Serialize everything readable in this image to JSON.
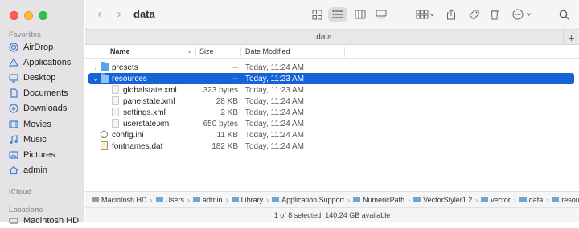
{
  "window": {
    "title": "data"
  },
  "sidebar": {
    "favorites_label": "Favorites",
    "items": [
      {
        "label": "AirDrop",
        "icon": "airdrop-icon"
      },
      {
        "label": "Applications",
        "icon": "applications-icon"
      },
      {
        "label": "Desktop",
        "icon": "desktop-icon"
      },
      {
        "label": "Documents",
        "icon": "documents-icon"
      },
      {
        "label": "Downloads",
        "icon": "downloads-icon"
      },
      {
        "label": "Movies",
        "icon": "movies-icon"
      },
      {
        "label": "Music",
        "icon": "music-icon"
      },
      {
        "label": "Pictures",
        "icon": "pictures-icon"
      },
      {
        "label": "admin",
        "icon": "home-icon"
      }
    ],
    "icloud_label": "iCloud",
    "locations_label": "Locations",
    "locations": [
      {
        "label": "Macintosh HD",
        "icon": "harddrive-icon"
      }
    ]
  },
  "tabbar": {
    "title": "data"
  },
  "columns": {
    "name": "Name",
    "size": "Size",
    "date": "Date Modified"
  },
  "files": [
    {
      "name": "presets",
      "size": "--",
      "date": "Today, 11:24 AM",
      "kind": "folder",
      "expanded": false
    },
    {
      "name": "resources",
      "size": "--",
      "date": "Today, 11:23 AM",
      "kind": "folder",
      "expanded": true,
      "selected": true
    },
    {
      "name": "globalstate.xml",
      "size": "323 bytes",
      "date": "Today, 11:23 AM",
      "kind": "doc"
    },
    {
      "name": "panelstate.xml",
      "size": "28 KB",
      "date": "Today, 11:24 AM",
      "kind": "doc"
    },
    {
      "name": "settings.xml",
      "size": "2 KB",
      "date": "Today, 11:24 AM",
      "kind": "doc"
    },
    {
      "name": "userstate.xml",
      "size": "650 bytes",
      "date": "Today, 11:24 AM",
      "kind": "doc"
    },
    {
      "name": "config.ini",
      "size": "11 KB",
      "date": "Today, 11:24 AM",
      "kind": "ini"
    },
    {
      "name": "fontnames.dat",
      "size": "182 KB",
      "date": "Today, 11:24 AM",
      "kind": "dat"
    }
  ],
  "path": [
    "Macintosh HD",
    "Users",
    "admin",
    "Library",
    "Application Support",
    "NumericPath",
    "VectorStyler1.2",
    "vector",
    "data",
    "resources"
  ],
  "status": {
    "text": "1 of 8 selected, 140.24 GB available"
  },
  "colors": {
    "selection": "#1663d8",
    "folder": "#58a6e8",
    "sidebar": "#e6e3e6"
  }
}
